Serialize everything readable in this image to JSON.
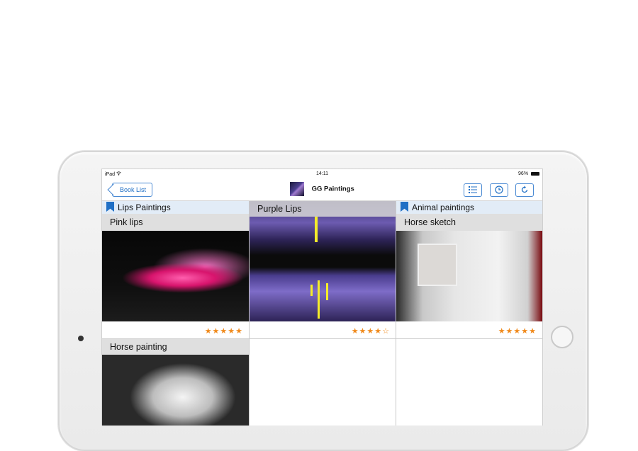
{
  "device": {
    "status_bar": {
      "left": "iPad",
      "time": "14:11",
      "battery": "96%"
    }
  },
  "navbar": {
    "back_label": "Book List",
    "title": "GG Paintings",
    "icons": [
      "list-icon",
      "history-clock-icon",
      "refresh-icon"
    ]
  },
  "shelves": [
    {
      "label": "Lips Paintings"
    },
    {
      "label": "Animal paintings"
    }
  ],
  "items": [
    {
      "title": "Pink lips",
      "rating": "★★★★★"
    },
    {
      "title": "Purple Lips",
      "rating": "★★★★☆"
    },
    {
      "title": "Horse sketch",
      "rating": "★★★★★"
    },
    {
      "title": "Horse painting"
    }
  ],
  "colors": {
    "accent": "#1f6fc5",
    "shelf_bg": "#e2ecf7",
    "star": "#f08a1c"
  }
}
